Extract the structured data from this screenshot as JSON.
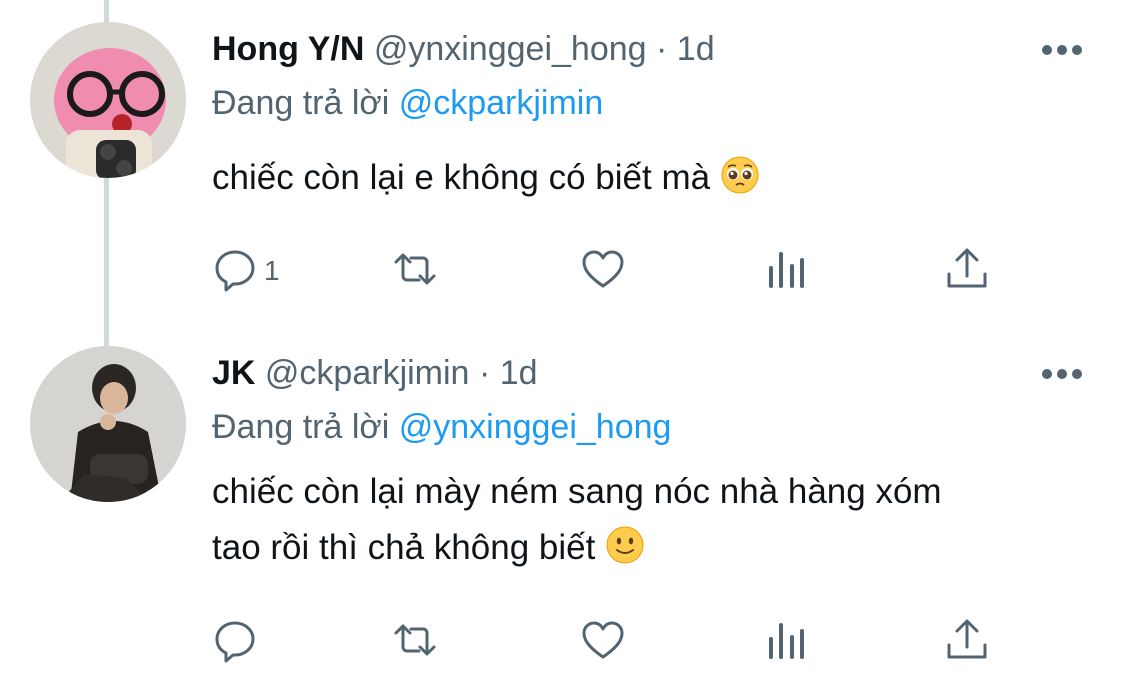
{
  "tweets": [
    {
      "display_name": "Hong Y/N",
      "handle": "@ynxinggei_hong",
      "time": "1d",
      "reply_prefix": "Đang trả lời",
      "reply_to": "@ckparkjimin",
      "text_lines": [
        "chiếc còn lại e không có biết mà"
      ],
      "emoji": "pleading-face",
      "reply_count": "1"
    },
    {
      "display_name": "JK",
      "handle": "@ckparkjimin",
      "time": "1d",
      "reply_prefix": "Đang trả lời",
      "reply_to": "@ynxinggei_hong",
      "text_lines": [
        "chiếc còn lại mày ném sang nóc nhà hàng xóm",
        "tao rồi thì chả không biết"
      ],
      "emoji": "slightly-smiling-face",
      "reply_count": ""
    }
  ],
  "separator": "·",
  "icons": [
    "more-icon",
    "reply-icon",
    "retweet-icon",
    "like-icon",
    "analytics-icon",
    "share-icon"
  ],
  "colors": {
    "link": "#1d9bf0",
    "secondary": "#536471",
    "text": "#0f1419",
    "thread_line": "#cfd9de"
  }
}
